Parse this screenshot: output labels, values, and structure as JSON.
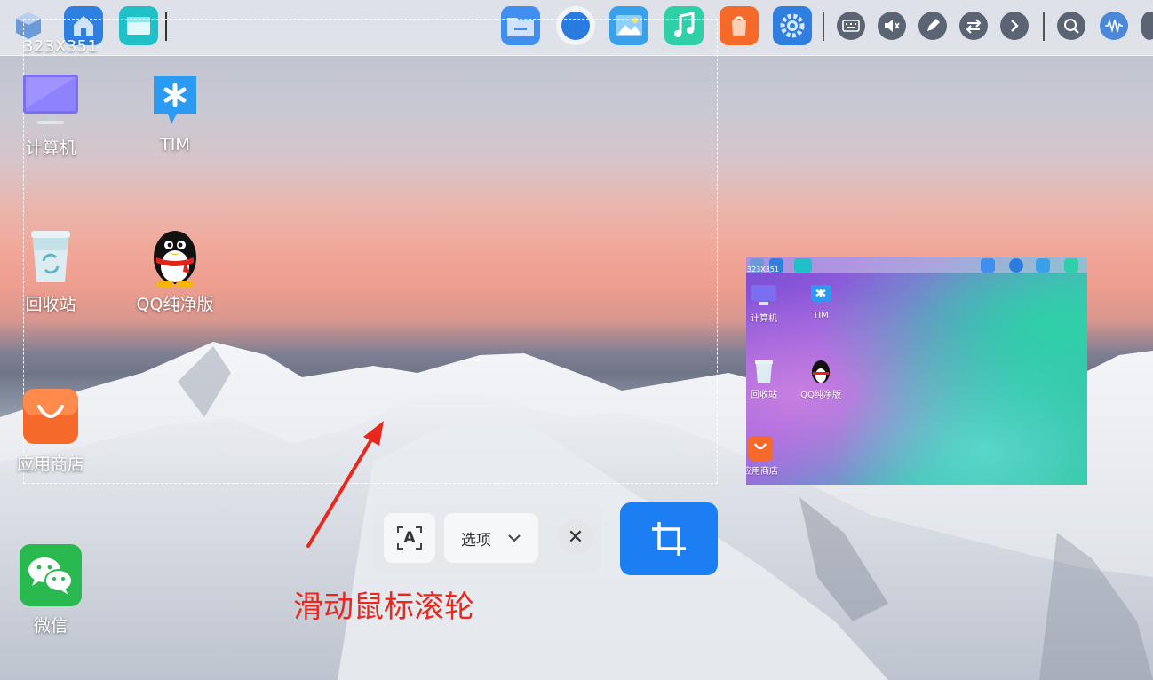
{
  "selection": {
    "size_label": "323X351"
  },
  "desktop": {
    "items": [
      {
        "label": "计算机",
        "icon": "monitor-icon"
      },
      {
        "label": "TIM",
        "icon": "tim-icon"
      },
      {
        "label": "回收站",
        "icon": "trash-icon"
      },
      {
        "label": "QQ纯净版",
        "icon": "qq-penguin-icon"
      },
      {
        "label": "应用商店",
        "icon": "app-store-icon"
      },
      {
        "label": "微信",
        "icon": "wechat-icon"
      }
    ]
  },
  "toolbar": {
    "ocr_icon_text": "A",
    "options_label": "选项",
    "close_glyph": "✕"
  },
  "hint": {
    "text": "滑动鼠标滚轮"
  },
  "preview": {
    "size_label": "323X351",
    "items": [
      {
        "label": "计算机"
      },
      {
        "label": "TIM"
      },
      {
        "label": "回收站"
      },
      {
        "label": "QQ纯净版"
      },
      {
        "label": "应用商店"
      }
    ]
  },
  "colors": {
    "accent": "#1b7ef2",
    "hint_red": "#e8281f",
    "store_orange": "#f5692a",
    "wechat_green": "#2ab94f"
  }
}
